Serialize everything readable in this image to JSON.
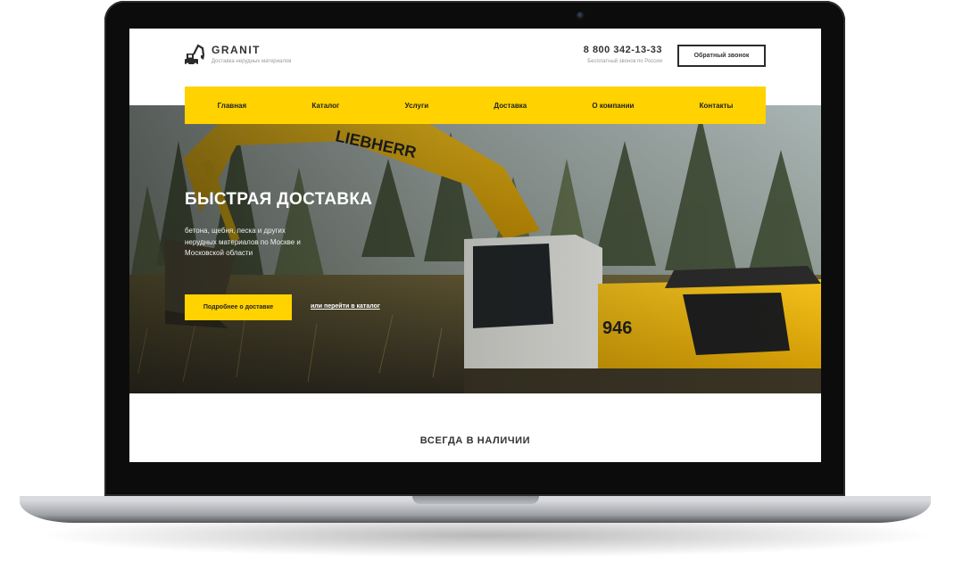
{
  "header": {
    "brand": "GRANIT",
    "tagline": "Доставка нерудных материалов",
    "phone": "8 800 342-13-33",
    "phone_note": "Бесплатный звонок по России",
    "callback_label": "Обратный звонок"
  },
  "nav": {
    "items": [
      {
        "label": "Главная"
      },
      {
        "label": "Каталог"
      },
      {
        "label": "Услуги"
      },
      {
        "label": "Доставка"
      },
      {
        "label": "О компании"
      },
      {
        "label": "Контакты"
      }
    ]
  },
  "hero": {
    "title": "БЫСТРАЯ ДОСТАВКА",
    "subtitle": "бетона, щебня, песка и других нерудных материалов по Москве и Московской области",
    "button_label": "Подробнее о доставке",
    "link_label": "или перейти в каталог",
    "machine_brand": "LIEBHERR",
    "machine_model": "946"
  },
  "section": {
    "title": "ВСЕГДА В НАЛИЧИИ"
  },
  "colors": {
    "accent": "#ffd200",
    "text_dark": "#333333"
  }
}
